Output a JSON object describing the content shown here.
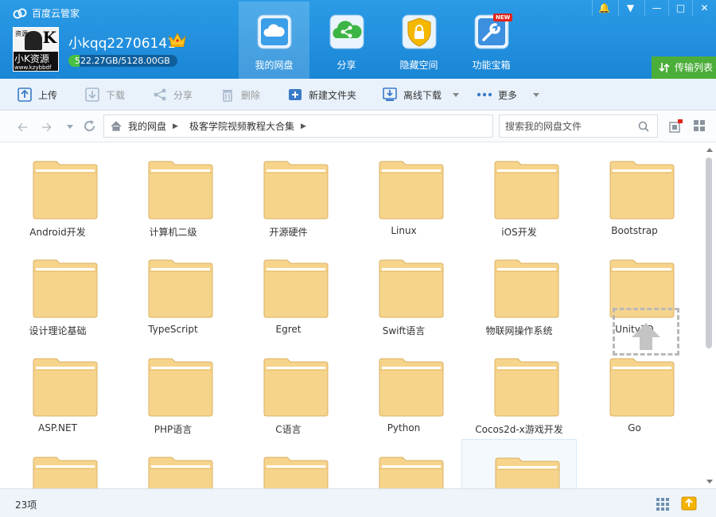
{
  "app": {
    "title": "百度云管家"
  },
  "user": {
    "name": "小kqq22706141",
    "quota_text": "522.27GB/5128.00GB",
    "quota_fraction": 0.102,
    "avatar_text": "小K资源",
    "avatar_small": "www.kzybbdf",
    "avatar_tiny": "资源"
  },
  "nav": {
    "tabs": [
      {
        "label": "我的网盘",
        "icon": "cloud-drive-icon"
      },
      {
        "label": "分享",
        "icon": "share-icon"
      },
      {
        "label": "隐藏空间",
        "icon": "lock-icon"
      },
      {
        "label": "功能宝箱",
        "icon": "toolbox-icon"
      }
    ],
    "new_badge": "NEW",
    "transfer_label": "传输列表"
  },
  "toolbar": {
    "upload": "上传",
    "download": "下载",
    "share": "分享",
    "delete": "删除",
    "new_folder": "新建文件夹",
    "offline_download": "离线下载",
    "more": "更多"
  },
  "address": {
    "root": "我的网盘",
    "current": "极客学院视频教程大合集",
    "search_placeholder": "搜索我的网盘文件"
  },
  "folders": [
    "Android开发",
    "计算机二级",
    "开源硬件",
    "Linux",
    "iOS开发",
    "Bootstrap",
    "设计理论基础",
    "TypeScript",
    "Egret",
    "Swift语言",
    "物联网操作系统",
    "Unity3D",
    "ASP.NET",
    "PHP语言",
    "C语言",
    "Python",
    "Cocos2d-x游戏开发",
    "Go",
    "",
    "",
    "",
    "",
    ""
  ],
  "status": {
    "count": "23项"
  },
  "colors": {
    "header": "#1a86d6",
    "folder": "#f6d48c",
    "folder_stroke": "#d9b163",
    "transfer": "#4cae3a",
    "quota_fill": "#47c146"
  }
}
